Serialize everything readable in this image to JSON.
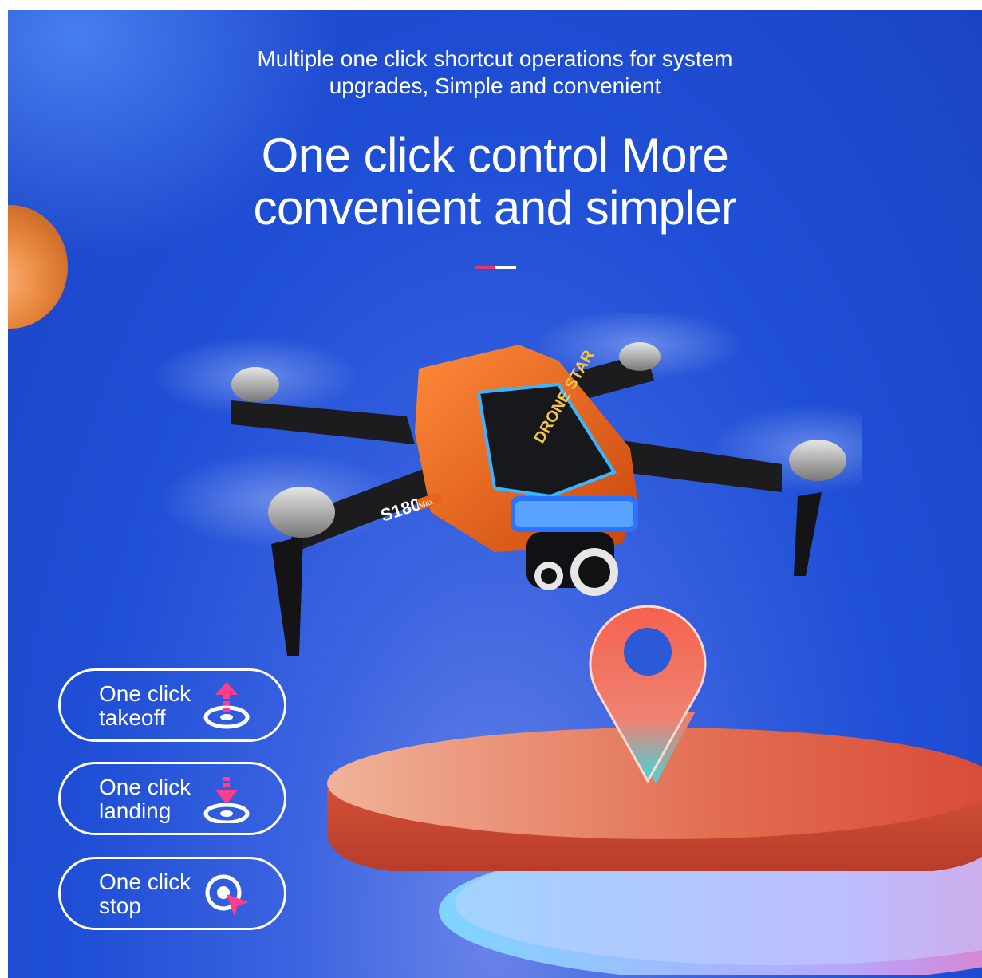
{
  "header": {
    "subtitle_line1": "Multiple one click shortcut operations for system",
    "subtitle_line2": "upgrades, Simple and convenient",
    "title_line1": "One click control More",
    "title_line2": "convenient and simpler"
  },
  "product": {
    "model_label": "S180",
    "model_badge": "Max",
    "body_logo": "DRONE STAR"
  },
  "features": [
    {
      "label": "One click\ntakeoff",
      "icon": "takeoff-icon"
    },
    {
      "label": "One click\nlanding",
      "icon": "landing-icon"
    },
    {
      "label": "One click\nstop",
      "icon": "stop-icon"
    }
  ],
  "colors": {
    "background": "#1f4fd6",
    "accent_pink": "#e23a6e",
    "drone_orange": "#e8641c",
    "pin_red": "#f36b55",
    "pin_cyan": "#4fd1d9"
  }
}
